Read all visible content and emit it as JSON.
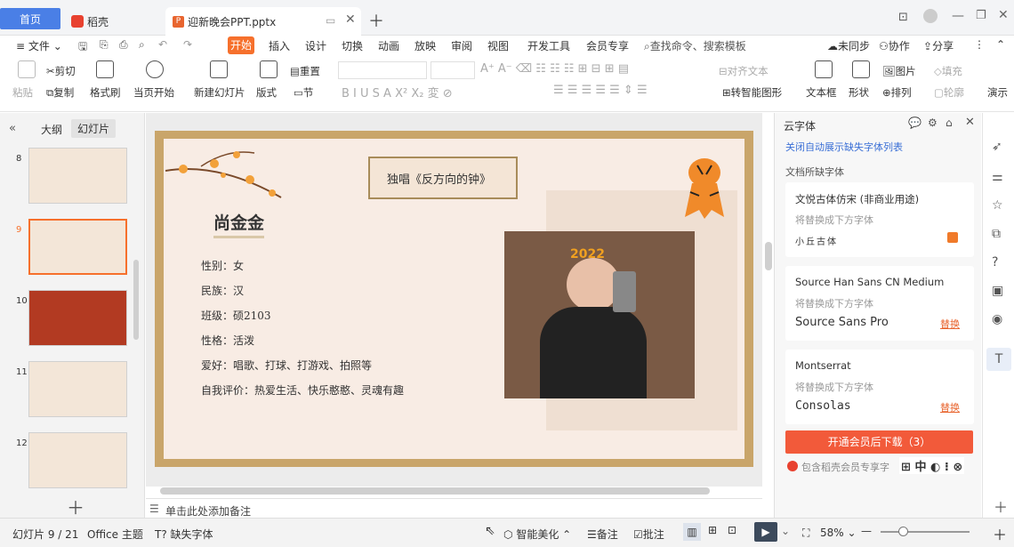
{
  "tabs": {
    "home": "首页",
    "daoke": "稻壳",
    "doc": "迎新晚会PPT.pptx"
  },
  "menu": {
    "file": "文件",
    "start": "开始",
    "items": [
      "插入",
      "设计",
      "切换",
      "动画",
      "放映",
      "审阅",
      "视图",
      "开发工具",
      "会员专享"
    ],
    "search": "查找命令、搜索模板",
    "unsynced": "未同步",
    "collab": "协作",
    "share": "分享"
  },
  "ribbon": {
    "paste": "粘贴",
    "cut": "剪切",
    "copy": "复制",
    "format_painter": "格式刷",
    "from_current": "当页开始",
    "new_slide": "新建幻灯片",
    "layout": "版式",
    "reset": "重置",
    "section": "节",
    "align_text": "对齐文本",
    "smartart": "转智能图形",
    "textbox": "文本框",
    "shape": "形状",
    "arrange": "排列",
    "picture": "图片",
    "fill": "填充",
    "outline": "轮廓",
    "present": "演示"
  },
  "left_panel": {
    "outline_tab": "大纲",
    "slides_tab": "幻灯片",
    "slide_numbers": [
      "8",
      "9",
      "10",
      "11",
      "12"
    ]
  },
  "slide": {
    "banner": "独唱《反方向的钟》",
    "name": "尚金金",
    "fields": [
      "性别：女",
      "民族：汉",
      "班级：硕2103",
      "性格：活泼",
      "爱好：唱歌、打球、打游戏、拍照等",
      "自我评价：热爱生活、快乐憨憨、灵魂有趣"
    ],
    "photo_overlay": "2022"
  },
  "notes_placeholder": "单击此处添加备注",
  "right_panel": {
    "title": "云字体",
    "link": "关闭自动展示缺失字体列表",
    "section": "文档所缺字体",
    "fonts": [
      {
        "name": "文悦古体仿宋 (非商业用途)",
        "hint": "将替换成下方字体",
        "replacement": "小丘古体",
        "action": ""
      },
      {
        "name": "Source Han Sans CN Medium",
        "hint": "将替换成下方字体",
        "replacement": "Source Sans Pro",
        "action": "替换"
      },
      {
        "name": "Montserrat",
        "hint": "将替换成下方字体",
        "replacement": "Consolas",
        "action": "替换"
      }
    ],
    "download_btn": "开通会员后下载（3）",
    "member_hint": "包含稻壳会员专享字",
    "ime": "中"
  },
  "status": {
    "slide_info": "幻灯片 9 / 21",
    "theme": "Office 主题",
    "missing_font": "缺失字体",
    "beautify": "智能美化",
    "notes": "备注",
    "comments": "批注",
    "zoom": "58%"
  },
  "colors": {
    "accent": "#f6702c",
    "blue": "#4a7fe6",
    "download": "#f25a3a"
  }
}
